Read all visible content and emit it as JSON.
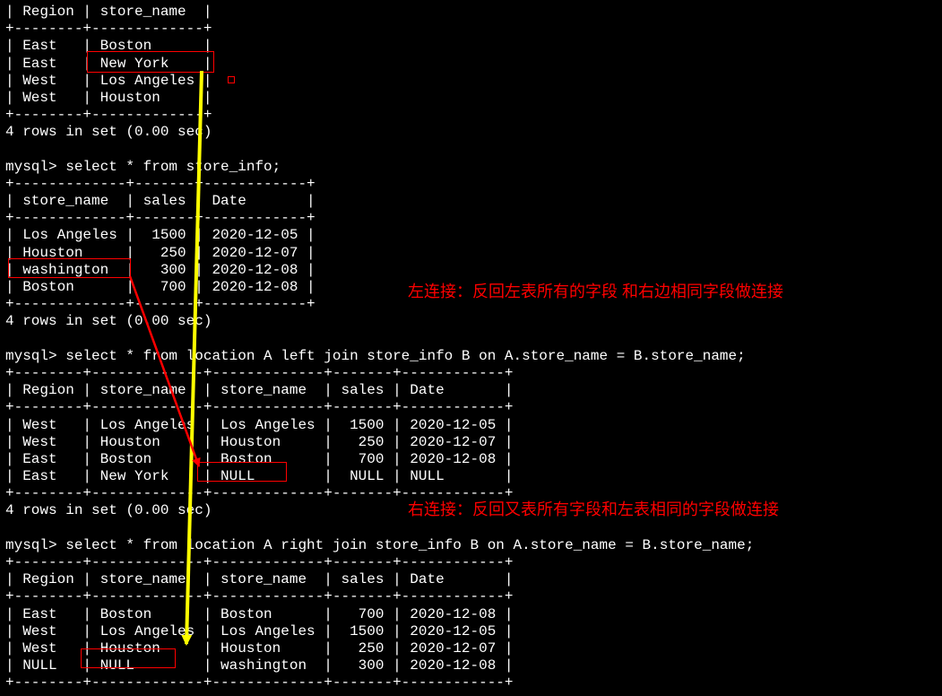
{
  "table1": {
    "header": "| Region | store_name  |",
    "sep": "+--------+-------------+",
    "rows": [
      "| East   | Boston      |",
      "| East   | New York    |",
      "| West   | Los Angeles |",
      "| West   | Houston     |"
    ],
    "footer": "4 rows in set (0.00 sec)"
  },
  "query2": "mysql> select * from store_info;",
  "table2": {
    "sep": "+-------------+-------+------------+",
    "header": "| store_name  | sales | Date       |",
    "rows": [
      "| Los Angeles |  1500 | 2020-12-05 |",
      "| Houston     |   250 | 2020-12-07 |",
      "| washington  |   300 | 2020-12-08 |",
      "| Boston      |   700 | 2020-12-08 |"
    ],
    "footer": "4 rows in set (0.00 sec)"
  },
  "query3": "mysql> select * from location A left join store_info B on A.store_name = B.store_name;",
  "table3": {
    "sep": "+--------+-------------+-------------+-------+------------+",
    "header": "| Region | store_name  | store_name  | sales | Date       |",
    "rows": [
      "| West   | Los Angeles | Los Angeles |  1500 | 2020-12-05 |",
      "| West   | Houston     | Houston     |   250 | 2020-12-07 |",
      "| East   | Boston      | Boston      |   700 | 2020-12-08 |",
      "| East   | New York    | NULL        |  NULL | NULL       |"
    ],
    "footer": "4 rows in set (0.00 sec)"
  },
  "query4": "mysql> select * from location A right join store_info B on A.store_name = B.store_name;",
  "table4": {
    "sep": "+--------+-------------+-------------+-------+------------+",
    "header": "| Region | store_name  | store_name  | sales | Date       |",
    "rows": [
      "| East   | Boston      | Boston      |   700 | 2020-12-08 |",
      "| West   | Los Angeles | Los Angeles |  1500 | 2020-12-05 |",
      "| West   | Houston     | Houston     |   250 | 2020-12-07 |",
      "| NULL   | NULL        | washington  |   300 | 2020-12-08 |"
    ]
  },
  "annotations": {
    "left_join": "左连接：反回左表所有的字段  和右边相同字段做连接",
    "right_join": "右连接：反回又表所有字段和左表相同的字段做连接"
  }
}
